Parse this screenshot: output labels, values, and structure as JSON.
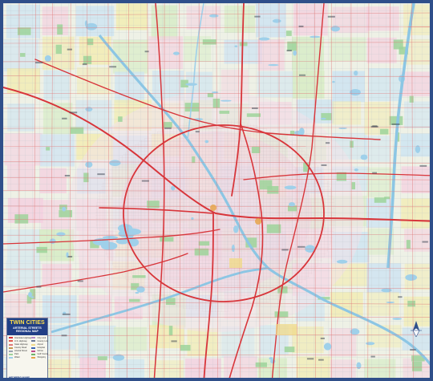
{
  "map": {
    "title_line1": "TWIN CITIES",
    "title_line2": "ARTERIAL STREETS",
    "title_line3": "REGIONAL MAP",
    "publisher": "HEDBERG MAPS",
    "compass_icon": "north-arrow-icon",
    "colors": {
      "frame": "#2f4f8a",
      "water": "#9fd0ea",
      "park": "#9ed39a",
      "highway": "#d8353a",
      "arterial": "#e07a7a",
      "street": "#9aa3b0",
      "county_yellow": "#f2ecb0",
      "county_pink": "#f4d0e0",
      "county_blue": "#cde4f2",
      "county_green": "#d6ecc4",
      "legend_header": "#213f86",
      "legend_title": "#ffe04a"
    },
    "legend_items": [
      {
        "label": "Interstate Highway",
        "color": "#d8353a"
      },
      {
        "label": "U.S. Highway",
        "color": "#e05a50"
      },
      {
        "label": "State Highway",
        "color": "#e07a7a"
      },
      {
        "label": "County Road",
        "color": "#c79a55"
      },
      {
        "label": "Arterial Street",
        "color": "#9aa3b0"
      },
      {
        "label": "Park",
        "color": "#9ed39a"
      },
      {
        "label": "Water",
        "color": "#9fd0ea"
      },
      {
        "label": "City Limit",
        "color": "#b58bc7"
      },
      {
        "label": "County Line",
        "color": "#6b7a99"
      },
      {
        "label": "Airport",
        "color": "#f0d98a"
      },
      {
        "label": "Hospital",
        "color": "#3a62b5"
      },
      {
        "label": "School",
        "color": "#c24a8a"
      },
      {
        "label": "Golf Course",
        "color": "#6fb36a"
      },
      {
        "label": "Shopping",
        "color": "#e6a44a"
      }
    ]
  }
}
